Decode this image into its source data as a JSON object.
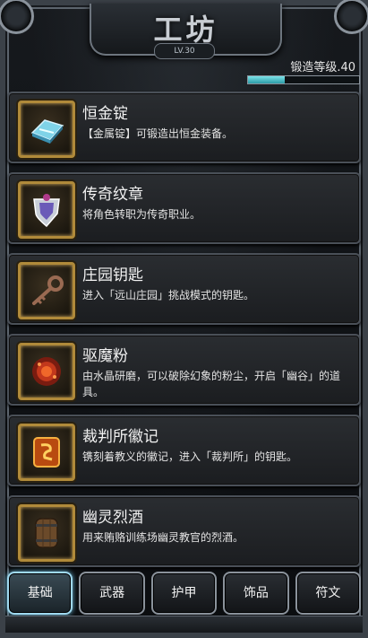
{
  "header": {
    "title": "工坊",
    "level_badge": "LV.30"
  },
  "forge": {
    "label": "锻造等级.40",
    "progress": 0.33,
    "bar_color": "#5fd0d8"
  },
  "items": [
    {
      "name": "恒金锭",
      "desc": "【金属锭】可锻造出恒金装备。",
      "icon": "metal-ingot-icon"
    },
    {
      "name": "传奇纹章",
      "desc": "将角色转职为传奇职业。",
      "icon": "legendary-crest-icon"
    },
    {
      "name": "庄园钥匙",
      "desc": "进入「远山庄园」挑战模式的钥匙。",
      "icon": "manor-key-icon"
    },
    {
      "name": "驱魔粉",
      "desc": "由水晶研磨，可以破除幻象的粉尘，开启「幽谷」的道具。",
      "icon": "exorcism-powder-icon"
    },
    {
      "name": "裁判所徽记",
      "desc": "镌刻着教义的徽记，进入「裁判所」的钥匙。",
      "icon": "tribunal-emblem-icon"
    },
    {
      "name": "幽灵烈酒",
      "desc": "用来贿赂训练场幽灵教官的烈酒。",
      "icon": "ghost-spirits-barrel-icon"
    }
  ],
  "tabs": [
    {
      "label": "基础",
      "active": true
    },
    {
      "label": "武器",
      "active": false
    },
    {
      "label": "护甲",
      "active": false
    },
    {
      "label": "饰品",
      "active": false
    },
    {
      "label": "符文",
      "active": false
    }
  ],
  "colors": {
    "frame": "#3b4148",
    "icon_border": "#b08a3a",
    "active_tab": "#9fd8ef"
  }
}
